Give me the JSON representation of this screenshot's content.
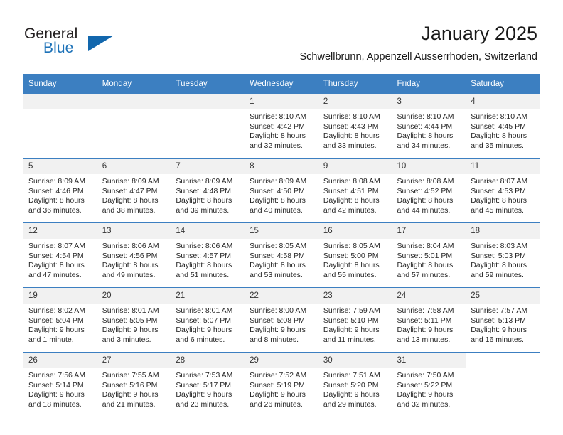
{
  "brand": {
    "name_part1": "General",
    "name_part2": "Blue",
    "triangle_color": "#1267ad",
    "blue_text_color": "#1d72b8"
  },
  "header": {
    "title": "January 2025",
    "subtitle": "Schwellbrunn, Appenzell Ausserrhoden, Switzerland",
    "header_bg_color": "#3c7fc1",
    "header_text_color": "#ffffff"
  },
  "calendar": {
    "weekday_headers": [
      "Sunday",
      "Monday",
      "Tuesday",
      "Wednesday",
      "Thursday",
      "Friday",
      "Saturday"
    ],
    "weeks": [
      [
        {
          "day": "",
          "empty": true,
          "blank": false,
          "sunrise": "",
          "sunset": "",
          "daylight_line1": "",
          "daylight_line2": ""
        },
        {
          "day": "",
          "empty": true,
          "blank": false,
          "sunrise": "",
          "sunset": "",
          "daylight_line1": "",
          "daylight_line2": ""
        },
        {
          "day": "",
          "empty": true,
          "blank": false,
          "sunrise": "",
          "sunset": "",
          "daylight_line1": "",
          "daylight_line2": ""
        },
        {
          "day": "1",
          "empty": false,
          "blank": false,
          "sunrise": "Sunrise: 8:10 AM",
          "sunset": "Sunset: 4:42 PM",
          "daylight_line1": "Daylight: 8 hours",
          "daylight_line2": "and 32 minutes."
        },
        {
          "day": "2",
          "empty": false,
          "blank": false,
          "sunrise": "Sunrise: 8:10 AM",
          "sunset": "Sunset: 4:43 PM",
          "daylight_line1": "Daylight: 8 hours",
          "daylight_line2": "and 33 minutes."
        },
        {
          "day": "3",
          "empty": false,
          "blank": false,
          "sunrise": "Sunrise: 8:10 AM",
          "sunset": "Sunset: 4:44 PM",
          "daylight_line1": "Daylight: 8 hours",
          "daylight_line2": "and 34 minutes."
        },
        {
          "day": "4",
          "empty": false,
          "blank": false,
          "sunrise": "Sunrise: 8:10 AM",
          "sunset": "Sunset: 4:45 PM",
          "daylight_line1": "Daylight: 8 hours",
          "daylight_line2": "and 35 minutes."
        }
      ],
      [
        {
          "day": "5",
          "empty": false,
          "blank": false,
          "sunrise": "Sunrise: 8:09 AM",
          "sunset": "Sunset: 4:46 PM",
          "daylight_line1": "Daylight: 8 hours",
          "daylight_line2": "and 36 minutes."
        },
        {
          "day": "6",
          "empty": false,
          "blank": false,
          "sunrise": "Sunrise: 8:09 AM",
          "sunset": "Sunset: 4:47 PM",
          "daylight_line1": "Daylight: 8 hours",
          "daylight_line2": "and 38 minutes."
        },
        {
          "day": "7",
          "empty": false,
          "blank": false,
          "sunrise": "Sunrise: 8:09 AM",
          "sunset": "Sunset: 4:48 PM",
          "daylight_line1": "Daylight: 8 hours",
          "daylight_line2": "and 39 minutes."
        },
        {
          "day": "8",
          "empty": false,
          "blank": false,
          "sunrise": "Sunrise: 8:09 AM",
          "sunset": "Sunset: 4:50 PM",
          "daylight_line1": "Daylight: 8 hours",
          "daylight_line2": "and 40 minutes."
        },
        {
          "day": "9",
          "empty": false,
          "blank": false,
          "sunrise": "Sunrise: 8:08 AM",
          "sunset": "Sunset: 4:51 PM",
          "daylight_line1": "Daylight: 8 hours",
          "daylight_line2": "and 42 minutes."
        },
        {
          "day": "10",
          "empty": false,
          "blank": false,
          "sunrise": "Sunrise: 8:08 AM",
          "sunset": "Sunset: 4:52 PM",
          "daylight_line1": "Daylight: 8 hours",
          "daylight_line2": "and 44 minutes."
        },
        {
          "day": "11",
          "empty": false,
          "blank": false,
          "sunrise": "Sunrise: 8:07 AM",
          "sunset": "Sunset: 4:53 PM",
          "daylight_line1": "Daylight: 8 hours",
          "daylight_line2": "and 45 minutes."
        }
      ],
      [
        {
          "day": "12",
          "empty": false,
          "blank": false,
          "sunrise": "Sunrise: 8:07 AM",
          "sunset": "Sunset: 4:54 PM",
          "daylight_line1": "Daylight: 8 hours",
          "daylight_line2": "and 47 minutes."
        },
        {
          "day": "13",
          "empty": false,
          "blank": false,
          "sunrise": "Sunrise: 8:06 AM",
          "sunset": "Sunset: 4:56 PM",
          "daylight_line1": "Daylight: 8 hours",
          "daylight_line2": "and 49 minutes."
        },
        {
          "day": "14",
          "empty": false,
          "blank": false,
          "sunrise": "Sunrise: 8:06 AM",
          "sunset": "Sunset: 4:57 PM",
          "daylight_line1": "Daylight: 8 hours",
          "daylight_line2": "and 51 minutes."
        },
        {
          "day": "15",
          "empty": false,
          "blank": false,
          "sunrise": "Sunrise: 8:05 AM",
          "sunset": "Sunset: 4:58 PM",
          "daylight_line1": "Daylight: 8 hours",
          "daylight_line2": "and 53 minutes."
        },
        {
          "day": "16",
          "empty": false,
          "blank": false,
          "sunrise": "Sunrise: 8:05 AM",
          "sunset": "Sunset: 5:00 PM",
          "daylight_line1": "Daylight: 8 hours",
          "daylight_line2": "and 55 minutes."
        },
        {
          "day": "17",
          "empty": false,
          "blank": false,
          "sunrise": "Sunrise: 8:04 AM",
          "sunset": "Sunset: 5:01 PM",
          "daylight_line1": "Daylight: 8 hours",
          "daylight_line2": "and 57 minutes."
        },
        {
          "day": "18",
          "empty": false,
          "blank": false,
          "sunrise": "Sunrise: 8:03 AM",
          "sunset": "Sunset: 5:03 PM",
          "daylight_line1": "Daylight: 8 hours",
          "daylight_line2": "and 59 minutes."
        }
      ],
      [
        {
          "day": "19",
          "empty": false,
          "blank": false,
          "sunrise": "Sunrise: 8:02 AM",
          "sunset": "Sunset: 5:04 PM",
          "daylight_line1": "Daylight: 9 hours",
          "daylight_line2": "and 1 minute."
        },
        {
          "day": "20",
          "empty": false,
          "blank": false,
          "sunrise": "Sunrise: 8:01 AM",
          "sunset": "Sunset: 5:05 PM",
          "daylight_line1": "Daylight: 9 hours",
          "daylight_line2": "and 3 minutes."
        },
        {
          "day": "21",
          "empty": false,
          "blank": false,
          "sunrise": "Sunrise: 8:01 AM",
          "sunset": "Sunset: 5:07 PM",
          "daylight_line1": "Daylight: 9 hours",
          "daylight_line2": "and 6 minutes."
        },
        {
          "day": "22",
          "empty": false,
          "blank": false,
          "sunrise": "Sunrise: 8:00 AM",
          "sunset": "Sunset: 5:08 PM",
          "daylight_line1": "Daylight: 9 hours",
          "daylight_line2": "and 8 minutes."
        },
        {
          "day": "23",
          "empty": false,
          "blank": false,
          "sunrise": "Sunrise: 7:59 AM",
          "sunset": "Sunset: 5:10 PM",
          "daylight_line1": "Daylight: 9 hours",
          "daylight_line2": "and 11 minutes."
        },
        {
          "day": "24",
          "empty": false,
          "blank": false,
          "sunrise": "Sunrise: 7:58 AM",
          "sunset": "Sunset: 5:11 PM",
          "daylight_line1": "Daylight: 9 hours",
          "daylight_line2": "and 13 minutes."
        },
        {
          "day": "25",
          "empty": false,
          "blank": false,
          "sunrise": "Sunrise: 7:57 AM",
          "sunset": "Sunset: 5:13 PM",
          "daylight_line1": "Daylight: 9 hours",
          "daylight_line2": "and 16 minutes."
        }
      ],
      [
        {
          "day": "26",
          "empty": false,
          "blank": false,
          "sunrise": "Sunrise: 7:56 AM",
          "sunset": "Sunset: 5:14 PM",
          "daylight_line1": "Daylight: 9 hours",
          "daylight_line2": "and 18 minutes."
        },
        {
          "day": "27",
          "empty": false,
          "blank": false,
          "sunrise": "Sunrise: 7:55 AM",
          "sunset": "Sunset: 5:16 PM",
          "daylight_line1": "Daylight: 9 hours",
          "daylight_line2": "and 21 minutes."
        },
        {
          "day": "28",
          "empty": false,
          "blank": false,
          "sunrise": "Sunrise: 7:53 AM",
          "sunset": "Sunset: 5:17 PM",
          "daylight_line1": "Daylight: 9 hours",
          "daylight_line2": "and 23 minutes."
        },
        {
          "day": "29",
          "empty": false,
          "blank": false,
          "sunrise": "Sunrise: 7:52 AM",
          "sunset": "Sunset: 5:19 PM",
          "daylight_line1": "Daylight: 9 hours",
          "daylight_line2": "and 26 minutes."
        },
        {
          "day": "30",
          "empty": false,
          "blank": false,
          "sunrise": "Sunrise: 7:51 AM",
          "sunset": "Sunset: 5:20 PM",
          "daylight_line1": "Daylight: 9 hours",
          "daylight_line2": "and 29 minutes."
        },
        {
          "day": "31",
          "empty": false,
          "blank": false,
          "sunrise": "Sunrise: 7:50 AM",
          "sunset": "Sunset: 5:22 PM",
          "daylight_line1": "Daylight: 9 hours",
          "daylight_line2": "and 32 minutes."
        },
        {
          "day": "",
          "empty": true,
          "blank": true,
          "sunrise": "",
          "sunset": "",
          "daylight_line1": "",
          "daylight_line2": ""
        }
      ]
    ]
  }
}
